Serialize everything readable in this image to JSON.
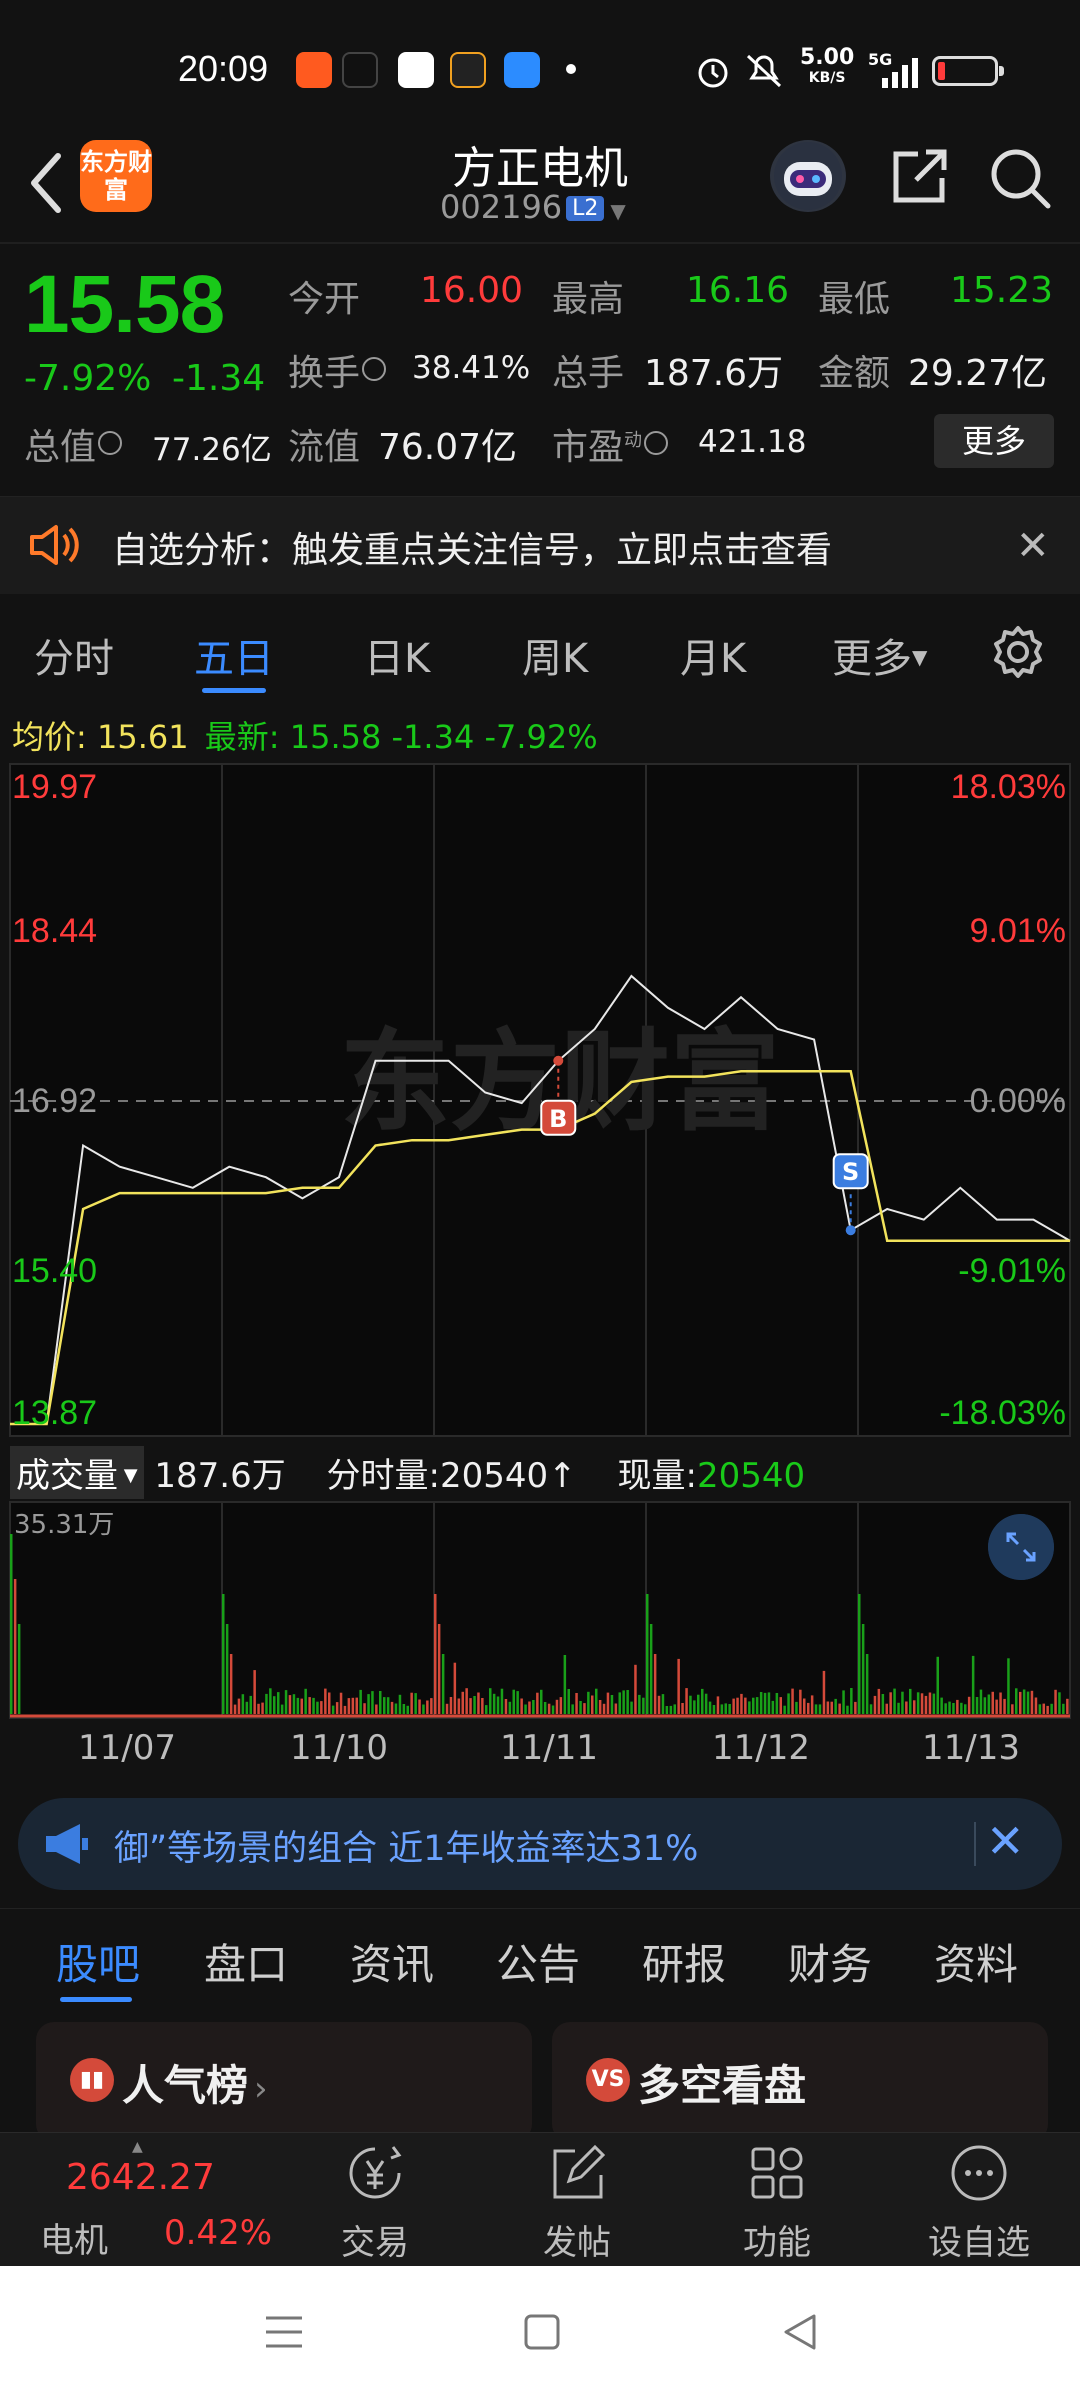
{
  "status_bar": {
    "time": "20:09",
    "net_speed": "5.00",
    "net_unit": "KB/S",
    "signal": "5G"
  },
  "header": {
    "logo_text": "东方财富",
    "stock_name": "方正电机",
    "stock_code": "002196",
    "level_badge": "L2"
  },
  "quote": {
    "price": "15.58",
    "change_pct": "-7.92%",
    "change": "-1.34",
    "open_label": "今开",
    "open": "16.00",
    "high_label": "最高",
    "high": "16.16",
    "low_label": "最低",
    "low": "15.23",
    "turnover_label": "换手",
    "turnover": "38.41%",
    "volume_label": "总手",
    "volume": "187.6万",
    "amount_label": "金额",
    "amount": "29.27亿",
    "mktcap_label": "总值",
    "mktcap": "77.26亿",
    "float_label": "流值",
    "float": "76.07亿",
    "pe_label": "市盈",
    "pe_sup": "动",
    "pe": "421.18",
    "more_label": "更多"
  },
  "notice": {
    "text": "自选分析：触发重点关注信号，立即点击查看"
  },
  "chart_tabs": [
    "分时",
    "五日",
    "日K",
    "周K",
    "月K",
    "更多"
  ],
  "info_line": {
    "avg_label": "均价:",
    "avg": "15.61",
    "latest_label": "最新:",
    "latest": "15.58",
    "change": "-1.34",
    "pct": "-7.92%"
  },
  "chart": {
    "watermark": "东方财富",
    "y_left": [
      "19.97",
      "18.44",
      "16.92",
      "15.40",
      "13.87"
    ],
    "y_right": [
      "18.03%",
      "9.01%",
      "0.00%",
      "-9.01%",
      "-18.03%"
    ],
    "buy_marker": "B",
    "sell_marker": "S"
  },
  "chart_data": {
    "type": "line",
    "title": "",
    "x_dates": [
      "11/07",
      "11/10",
      "11/11",
      "11/12",
      "11/13"
    ],
    "ylim": [
      13.87,
      19.97
    ],
    "prev_close": 16.92,
    "series": [
      {
        "name": "",
        "values": [
          13.87,
          13.87,
          16.5,
          16.3,
          16.2,
          16.1,
          16.3,
          16.2,
          16.0,
          16.2,
          17.3,
          17.3,
          17.3,
          17.0,
          16.9,
          17.3,
          17.6,
          18.1,
          17.8,
          17.6,
          17.9,
          17.6,
          17.5,
          15.7,
          15.9,
          15.8,
          16.1,
          15.8,
          15.8,
          15.6
        ]
      },
      {
        "name": "均价:",
        "values": [
          13.87,
          13.87,
          15.9,
          16.05,
          16.05,
          16.05,
          16.05,
          16.05,
          16.1,
          16.1,
          16.5,
          16.55,
          16.55,
          16.6,
          16.65,
          16.65,
          16.8,
          17.1,
          17.15,
          17.15,
          17.2,
          17.2,
          17.2,
          17.2,
          15.6,
          15.6,
          15.6,
          15.6,
          15.6,
          15.6
        ]
      }
    ]
  },
  "volume": {
    "label": "成交量",
    "total": "187.6万",
    "tick_label": "分时量:20540",
    "now_label": "现量:",
    "now": "20540",
    "max": "35.31万"
  },
  "ad": {
    "text": "御”等场景的组合 近1年收益率达31%"
  },
  "bottom_tabs": [
    "股吧",
    "盘口",
    "资讯",
    "公告",
    "研报",
    "财务",
    "资料"
  ],
  "cards": [
    {
      "title": "人气榜",
      "icon": "ranking-icon"
    },
    {
      "title": "多空看盘",
      "icon": "vs-icon"
    }
  ],
  "bottom_nav": {
    "index_value": "2642.27",
    "index_name": "电机",
    "index_pct": "0.42%",
    "items": [
      "交易",
      "发帖",
      "功能",
      "设自选"
    ]
  }
}
